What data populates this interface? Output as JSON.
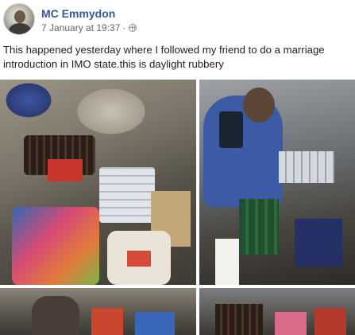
{
  "post": {
    "author": "MC Emmydon",
    "date": "7 January at 19:37",
    "separator": "·",
    "privacy_icon": "globe-icon",
    "text": "This happened yesterday where I followed my friend to do a marriage introduction in IMO state.this is daylight rubbery"
  },
  "colors": {
    "author_link": "#365899",
    "meta_text": "#606770",
    "body_text": "#1c1e21"
  },
  "photos": [
    {
      "name": "photo-1"
    },
    {
      "name": "photo-2"
    },
    {
      "name": "photo-3"
    },
    {
      "name": "photo-4"
    }
  ]
}
